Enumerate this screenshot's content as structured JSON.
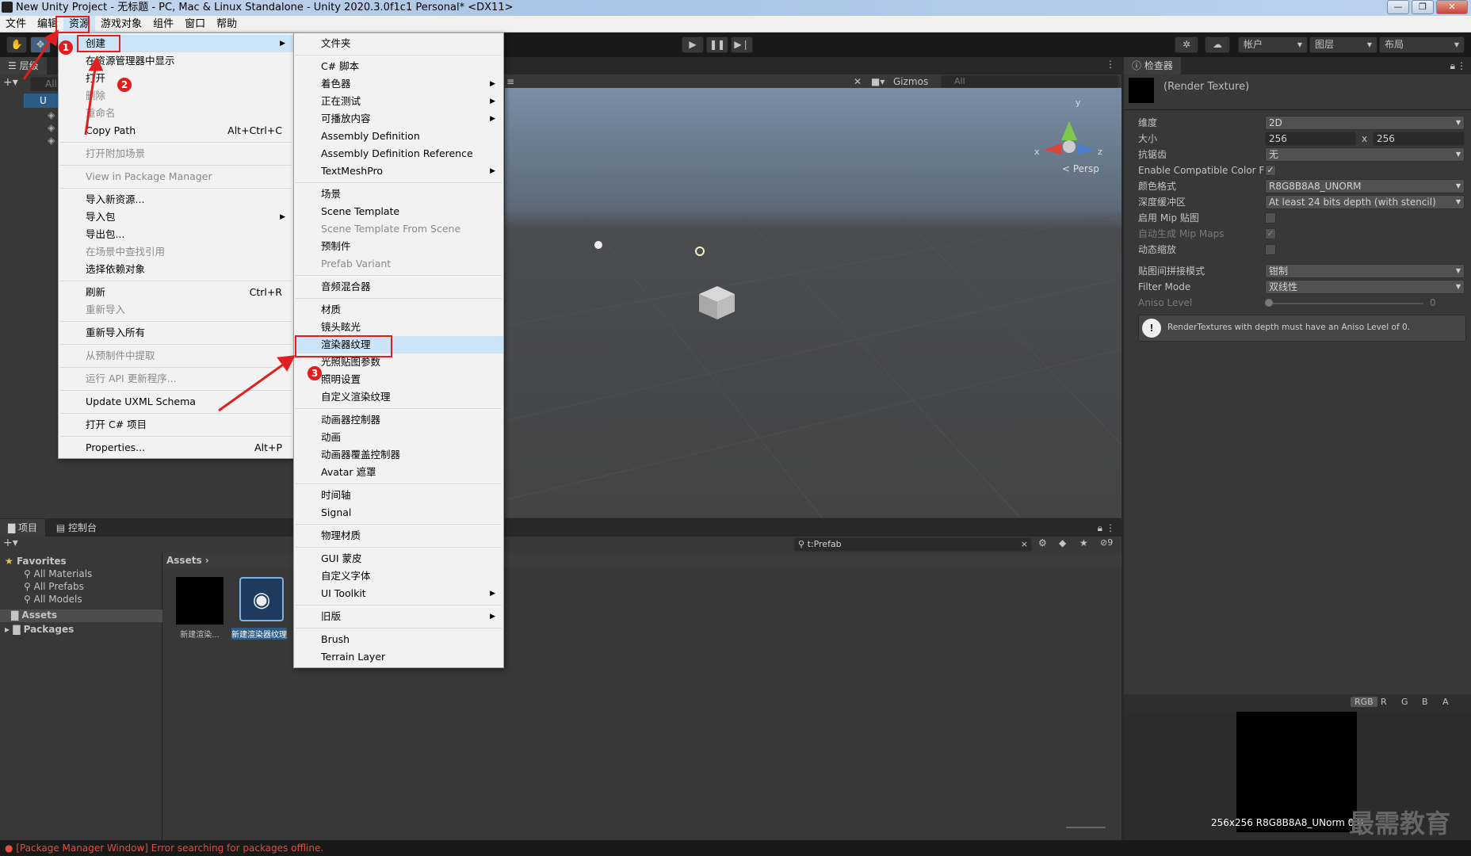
{
  "window": {
    "title": "New Unity Project - 无标题 - PC, Mac & Linux Standalone - Unity 2020.3.0f1c1 Personal* <DX11>",
    "minimize": "—",
    "maximize": "❐",
    "close": "✕"
  },
  "menubar": {
    "items": [
      "文件",
      "编辑",
      "资源",
      "游戏对象",
      "组件",
      "窗口",
      "帮助"
    ]
  },
  "toolbar": {
    "account": "帐户",
    "layers": "图层",
    "layout": "布局"
  },
  "hierarchy": {
    "tab": "层级",
    "search_placeholder": "All",
    "scene_prefix": "U"
  },
  "scene_view": {
    "gizmos": "Gizmos",
    "search_placeholder": "All",
    "persp": "< Persp",
    "axis_x": "x",
    "axis_y": "y",
    "axis_z": "z",
    "toolbar_fx": "≡"
  },
  "assets_menu": {
    "items": [
      {
        "label": "创建",
        "arrow": true,
        "highlight": true
      },
      {
        "label": "在资源管理器中显示"
      },
      {
        "label": "打开"
      },
      {
        "label": "删除",
        "disabled": true
      },
      {
        "label": "重命名",
        "disabled": true
      },
      {
        "label": "Copy Path",
        "shortcut": "Alt+Ctrl+C"
      },
      {
        "sep": true
      },
      {
        "label": "打开附加场景",
        "disabled": true
      },
      {
        "sep": true
      },
      {
        "label": "View in Package Manager",
        "disabled": true
      },
      {
        "sep": true
      },
      {
        "label": "导入新资源..."
      },
      {
        "label": "导入包",
        "arrow": true
      },
      {
        "label": "导出包..."
      },
      {
        "label": "在场景中查找引用",
        "disabled": true
      },
      {
        "label": "选择依赖对象"
      },
      {
        "sep": true
      },
      {
        "label": "刷新",
        "shortcut": "Ctrl+R"
      },
      {
        "label": "重新导入",
        "disabled": true
      },
      {
        "sep": true
      },
      {
        "label": "重新导入所有"
      },
      {
        "sep": true
      },
      {
        "label": "从预制件中提取",
        "disabled": true
      },
      {
        "sep": true
      },
      {
        "label": "运行 API 更新程序...",
        "disabled": true
      },
      {
        "sep": true
      },
      {
        "label": "Update UXML Schema"
      },
      {
        "sep": true
      },
      {
        "label": "打开 C# 项目"
      },
      {
        "sep": true
      },
      {
        "label": "Properties...",
        "shortcut": "Alt+P"
      }
    ]
  },
  "create_submenu": {
    "items": [
      {
        "label": "文件夹"
      },
      {
        "sep": true
      },
      {
        "label": "C# 脚本"
      },
      {
        "label": "着色器",
        "arrow": true
      },
      {
        "label": "正在测试",
        "arrow": true
      },
      {
        "label": "可播放内容",
        "arrow": true
      },
      {
        "label": "Assembly Definition"
      },
      {
        "label": "Assembly Definition Reference"
      },
      {
        "label": "TextMeshPro",
        "arrow": true
      },
      {
        "sep": true
      },
      {
        "label": "场景"
      },
      {
        "label": "Scene Template"
      },
      {
        "label": "Scene Template From Scene",
        "disabled": true
      },
      {
        "label": "预制件"
      },
      {
        "label": "Prefab Variant",
        "disabled": true
      },
      {
        "sep": true
      },
      {
        "label": "音频混合器"
      },
      {
        "sep": true
      },
      {
        "label": "材质"
      },
      {
        "label": "镜头眩光"
      },
      {
        "label": "渲染器纹理",
        "highlight": true
      },
      {
        "label": "光照贴图参数"
      },
      {
        "label": "照明设置"
      },
      {
        "label": "自定义渲染纹理"
      },
      {
        "sep": true
      },
      {
        "label": "动画器控制器"
      },
      {
        "label": "动画"
      },
      {
        "label": "动画器覆盖控制器"
      },
      {
        "label": "Avatar 遮罩"
      },
      {
        "sep": true
      },
      {
        "label": "时间轴"
      },
      {
        "label": "Signal"
      },
      {
        "sep": true
      },
      {
        "label": "物理材质"
      },
      {
        "sep": true
      },
      {
        "label": "GUI 蒙皮"
      },
      {
        "label": "自定义字体"
      },
      {
        "label": "UI Toolkit",
        "arrow": true
      },
      {
        "sep": true
      },
      {
        "label": "旧版",
        "arrow": true
      },
      {
        "sep": true
      },
      {
        "label": "Brush"
      },
      {
        "label": "Terrain Layer"
      }
    ]
  },
  "annotations": {
    "badge1": "1",
    "badge2": "2",
    "badge3": "3"
  },
  "inspector": {
    "tab": "检查器",
    "object": "(Render Texture)",
    "rows": {
      "dimension": {
        "label": "维度",
        "value": "2D"
      },
      "size": {
        "label": "大小",
        "w": "256",
        "x": "x",
        "h": "256"
      },
      "antialias": {
        "label": "抗锯齿",
        "value": "无"
      },
      "compat": {
        "label": "Enable Compatible Color F"
      },
      "color_format": {
        "label": "颜色格式",
        "value": "R8G8B8A8_UNORM"
      },
      "depth": {
        "label": "深度缓冲区",
        "value": "At least 24 bits depth (with stencil)"
      },
      "mip": {
        "label": "启用 Mip 贴图"
      },
      "automip": {
        "label": "自动生成 Mip Maps"
      },
      "dynscale": {
        "label": "动态缩放"
      },
      "wrap": {
        "label": "贴图间拼接模式",
        "value": "钳制"
      },
      "filter": {
        "label": "Filter Mode",
        "value": "双线性"
      },
      "aniso": {
        "label": "Aniso Level",
        "value": "0"
      }
    },
    "warning": "RenderTextures with depth must have an Aniso Level of 0.",
    "preview_channels": [
      "RGB",
      "R",
      "G",
      "B",
      "A"
    ],
    "preview_info": "256x256  R8G8B8A8_UNorm  0 B"
  },
  "project": {
    "tab_project": "项目",
    "tab_console": "控制台",
    "search_value": "t:Prefab",
    "count": "9",
    "favorites": "Favorites",
    "fav_items": [
      "All Materials",
      "All Prefabs",
      "All Models"
    ],
    "assets": "Assets",
    "packages": "Packages",
    "breadcrumb": "Assets",
    "files": [
      "新建渲染...",
      "新建渲染器纹理"
    ]
  },
  "statusbar": {
    "error": "[Package Manager Window] Error searching for packages offline."
  },
  "watermark": "最需教育"
}
